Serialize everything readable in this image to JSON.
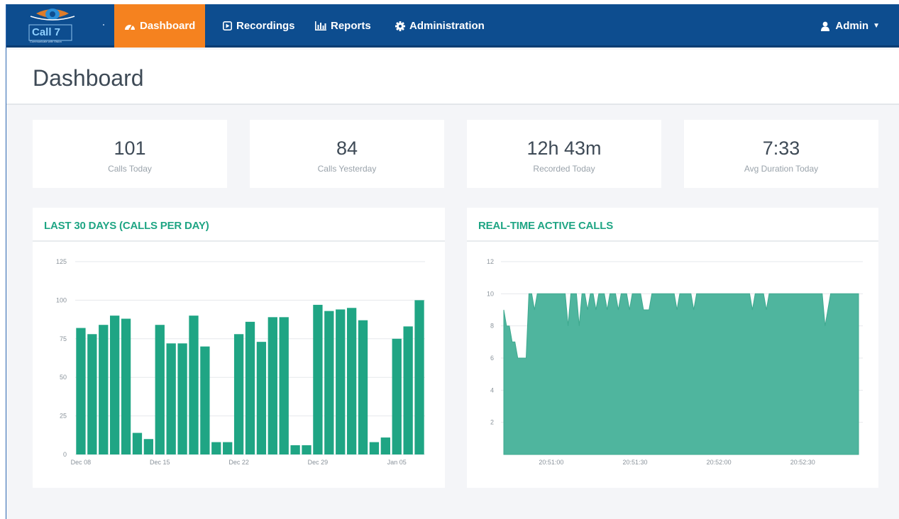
{
  "brand": {
    "logo_text": "Call 7",
    "logo_tagline": "Communicate with Vision"
  },
  "nav": {
    "items": [
      {
        "label": "Dashboard",
        "icon": "dashboard-icon",
        "active": true
      },
      {
        "label": "Recordings",
        "icon": "play-square-icon",
        "active": false
      },
      {
        "label": "Reports",
        "icon": "bar-chart-icon",
        "active": false
      },
      {
        "label": "Administration",
        "icon": "gear-icon",
        "active": false
      }
    ],
    "user": {
      "label": "Admin",
      "icon": "user-icon",
      "caret": "▼"
    }
  },
  "page": {
    "title": "Dashboard"
  },
  "stats": [
    {
      "value": "101",
      "label": "Calls Today"
    },
    {
      "value": "84",
      "label": "Calls Yesterday"
    },
    {
      "value": "12h 43m",
      "label": "Recorded Today"
    },
    {
      "value": "7:33",
      "label": "Avg Duration Today"
    }
  ],
  "colors": {
    "navbar": "#0d4d8f",
    "active_tab": "#f5821f",
    "accent": "#1fa584",
    "bar": "#1fa584",
    "area": "#4fb59e"
  },
  "chart_data": [
    {
      "type": "bar",
      "title": "LAST 30 DAYS (CALLS PER DAY)",
      "ylim": [
        0,
        125
      ],
      "yticks": [
        0,
        25,
        50,
        75,
        100,
        125
      ],
      "x_tick_labels": [
        "Dec 08",
        "Dec 15",
        "Dec 22",
        "Dec 29",
        "Jan 05"
      ],
      "categories": [
        "Dec 08",
        "Dec 09",
        "Dec 10",
        "Dec 11",
        "Dec 12",
        "Dec 13",
        "Dec 14",
        "Dec 15",
        "Dec 16",
        "Dec 17",
        "Dec 18",
        "Dec 19",
        "Dec 20",
        "Dec 21",
        "Dec 22",
        "Dec 23",
        "Dec 24",
        "Dec 25",
        "Dec 26",
        "Dec 27",
        "Dec 28",
        "Dec 29",
        "Dec 30",
        "Dec 31",
        "Jan 01",
        "Jan 02",
        "Jan 03",
        "Jan 04",
        "Jan 05",
        "Jan 06",
        "Jan 07"
      ],
      "values": [
        82,
        78,
        84,
        90,
        88,
        14,
        10,
        84,
        72,
        72,
        90,
        70,
        8,
        8,
        78,
        86,
        73,
        89,
        89,
        6,
        6,
        97,
        93,
        94,
        95,
        87,
        8,
        11,
        75,
        83,
        100
      ],
      "grid": true
    },
    {
      "type": "area",
      "title": "REAL-TIME ACTIVE CALLS",
      "ylim": [
        0,
        12
      ],
      "yticks": [
        2,
        4,
        6,
        8,
        10,
        12
      ],
      "x_tick_labels": [
        "20:51:00",
        "20:51:30",
        "20:52:00",
        "20:52:30"
      ],
      "x_tick_seconds": [
        60,
        90,
        120,
        150
      ],
      "x_range": [
        43,
        170
      ],
      "x": [
        43,
        44,
        45,
        46,
        47,
        48,
        49,
        50,
        51,
        52,
        53,
        54,
        55,
        56,
        57,
        58,
        59,
        60,
        61,
        62,
        63,
        64,
        65,
        66,
        67,
        68,
        69,
        70,
        71,
        72,
        73,
        74,
        75,
        76,
        77,
        78,
        79,
        80,
        81,
        82,
        83,
        84,
        85,
        86,
        87,
        88,
        89,
        90,
        91,
        92,
        93,
        94,
        95,
        96,
        97,
        98,
        99,
        100,
        101,
        102,
        103,
        104,
        105,
        106,
        107,
        108,
        109,
        110,
        111,
        112,
        113,
        114,
        115,
        116,
        117,
        118,
        119,
        120,
        121,
        122,
        123,
        124,
        125,
        126,
        127,
        128,
        129,
        130,
        131,
        132,
        133,
        134,
        135,
        136,
        137,
        138,
        139,
        140,
        141,
        142,
        143,
        144,
        145,
        146,
        147,
        148,
        149,
        150,
        151,
        152,
        153,
        154,
        155,
        156,
        157,
        158,
        159,
        160,
        161,
        162,
        163,
        164,
        165,
        166,
        167,
        168,
        169,
        170
      ],
      "values": [
        9,
        8,
        8,
        7,
        7,
        6,
        6,
        6,
        6,
        10,
        10,
        9,
        10,
        10,
        10,
        10,
        10,
        10,
        10,
        10,
        10,
        10,
        10,
        8,
        10,
        10,
        10,
        8,
        10,
        10,
        9,
        10,
        10,
        9,
        10,
        10,
        10,
        9,
        10,
        10,
        10,
        9,
        10,
        10,
        10,
        9,
        10,
        10,
        10,
        10,
        9,
        9,
        9,
        10,
        10,
        10,
        10,
        10,
        10,
        10,
        10,
        10,
        9,
        10,
        10,
        10,
        10,
        10,
        9,
        10,
        10,
        10,
        10,
        10,
        10,
        10,
        10,
        10,
        10,
        10,
        10,
        10,
        10,
        10,
        10,
        10,
        10,
        10,
        10,
        9,
        10,
        10,
        10,
        10,
        9,
        10,
        10,
        10,
        10,
        10,
        10,
        10,
        10,
        10,
        10,
        10,
        10,
        10,
        10,
        10,
        10,
        10,
        10,
        10,
        10,
        8,
        9,
        10,
        10,
        10,
        10,
        10,
        10,
        10,
        10,
        10,
        10,
        10
      ],
      "grid": true
    }
  ]
}
